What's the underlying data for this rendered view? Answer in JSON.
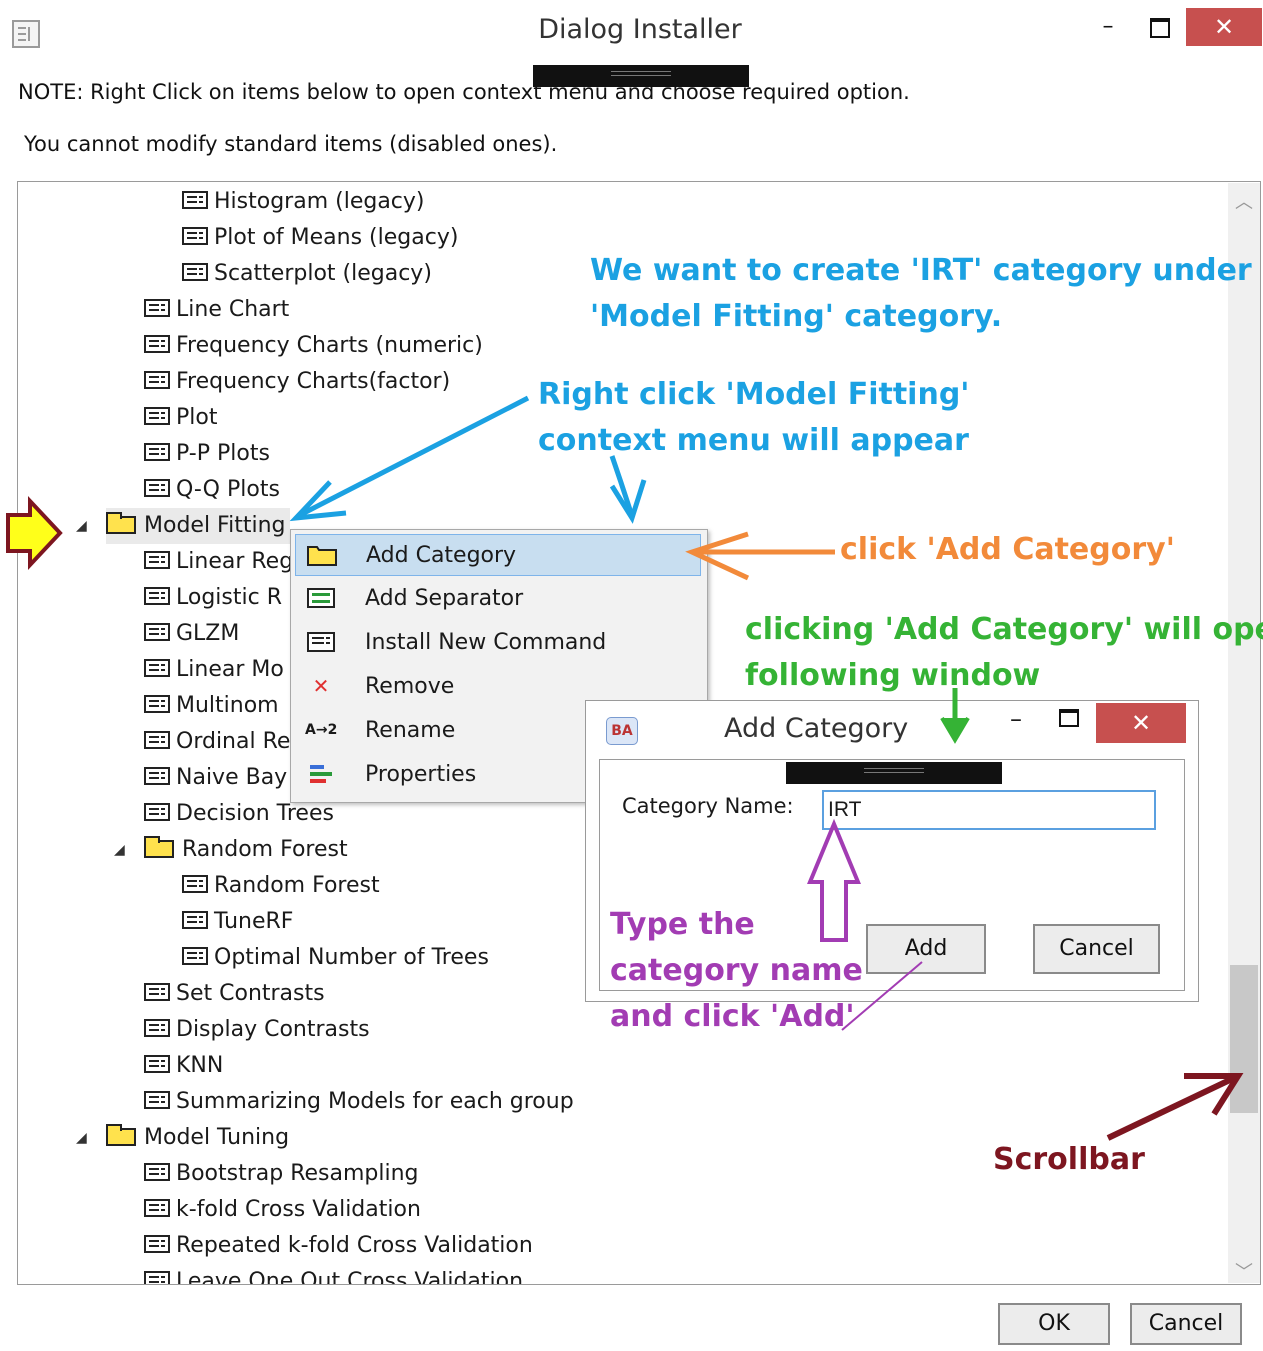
{
  "window": {
    "title": "Dialog Installer",
    "minimize_label": "–",
    "close_label": "✕"
  },
  "notes": {
    "line1": "NOTE: Right Click on items below to open context menu and choose required option.",
    "line2": "You cannot modify standard items (disabled ones)."
  },
  "tree": {
    "items": [
      {
        "label": "Histogram (legacy)",
        "type": "command",
        "level": 3
      },
      {
        "label": "Plot of Means (legacy)",
        "type": "command",
        "level": 3
      },
      {
        "label": "Scatterplot (legacy)",
        "type": "command",
        "level": 3
      },
      {
        "label": "Line Chart",
        "type": "command",
        "level": 2
      },
      {
        "label": "Frequency Charts (numeric)",
        "type": "command",
        "level": 2
      },
      {
        "label": "Frequency Charts(factor)",
        "type": "command",
        "level": 2
      },
      {
        "label": "Plot",
        "type": "command",
        "level": 2
      },
      {
        "label": "P-P Plots",
        "type": "command",
        "level": 2
      },
      {
        "label": "Q-Q Plots",
        "type": "command",
        "level": 2
      },
      {
        "label": "Model Fitting",
        "type": "category",
        "level": 1,
        "expanded": true
      },
      {
        "label": "Linear Reg",
        "type": "command",
        "level": 2
      },
      {
        "label": "Logistic R",
        "type": "command",
        "level": 2
      },
      {
        "label": "GLZM",
        "type": "command",
        "level": 2
      },
      {
        "label": "Linear Mo",
        "type": "command",
        "level": 2
      },
      {
        "label": "Multinom",
        "type": "command",
        "level": 2
      },
      {
        "label": "Ordinal Re",
        "type": "command",
        "level": 2
      },
      {
        "label": "Naive Bay",
        "type": "command",
        "level": 2
      },
      {
        "label": "Decision Trees",
        "type": "command",
        "level": 2
      },
      {
        "label": "Random Forest",
        "type": "category",
        "level": 2,
        "expanded": true
      },
      {
        "label": "Random Forest",
        "type": "command",
        "level": 3
      },
      {
        "label": "TuneRF",
        "type": "command",
        "level": 3
      },
      {
        "label": "Optimal Number of Trees",
        "type": "command",
        "level": 3
      },
      {
        "label": "Set Contrasts",
        "type": "command",
        "level": 2
      },
      {
        "label": "Display Contrasts",
        "type": "command",
        "level": 2
      },
      {
        "label": "KNN",
        "type": "command",
        "level": 2
      },
      {
        "label": "Summarizing Models for each group",
        "type": "command",
        "level": 2
      },
      {
        "label": "Model Tuning",
        "type": "category",
        "level": 1,
        "expanded": true
      },
      {
        "label": "Bootstrap Resampling",
        "type": "command",
        "level": 2
      },
      {
        "label": "k-fold Cross Validation",
        "type": "command",
        "level": 2
      },
      {
        "label": "Repeated k-fold Cross Validation",
        "type": "command",
        "level": 2
      },
      {
        "label": "Leave One Out Cross Validation",
        "type": "command",
        "level": 2
      }
    ]
  },
  "context_menu": {
    "items": [
      {
        "label": "Add Category",
        "icon": "folder-icon",
        "highlighted": true
      },
      {
        "label": "Add Separator",
        "icon": "separator-icon"
      },
      {
        "label": "Install New Command",
        "icon": "command-icon"
      },
      {
        "label": "Remove",
        "icon": "remove-x-icon"
      },
      {
        "label": "Rename",
        "icon": "rename-icon",
        "icon_text": "A→2"
      },
      {
        "label": "Properties",
        "icon": "properties-icon"
      }
    ]
  },
  "add_category_dialog": {
    "title": "Add Category",
    "icon_text": "BA",
    "min_label": "–",
    "close_label": "✕",
    "category_name_label": "Category Name:",
    "category_name_value": "IRT",
    "add_label": "Add",
    "cancel_label": "Cancel"
  },
  "footer": {
    "ok_label": "OK",
    "cancel_label": "Cancel"
  },
  "annotations": {
    "goal_line1": "We want to create 'IRT' category under",
    "goal_line2": "'Model Fitting' category.",
    "rightclick_line1": "Right click 'Model Fitting'",
    "rightclick_line2": "context menu will appear",
    "click_add": "click 'Add Category'",
    "window_line1": "clicking 'Add Category' will open",
    "window_line2": "following window",
    "type_line1": "Type the",
    "type_line2": "category name",
    "type_line3": "and click 'Add'",
    "scrollbar": "Scrollbar"
  },
  "colors": {
    "annot_blue": "#1ba1e2",
    "annot_orange": "#f28a3a",
    "annot_green": "#35b335",
    "annot_purple": "#a23cb3",
    "annot_darkred": "#7d1620",
    "close_red": "#c7504f",
    "menu_highlight": "#c8def0",
    "folder_yellow": "#ffe24d"
  }
}
